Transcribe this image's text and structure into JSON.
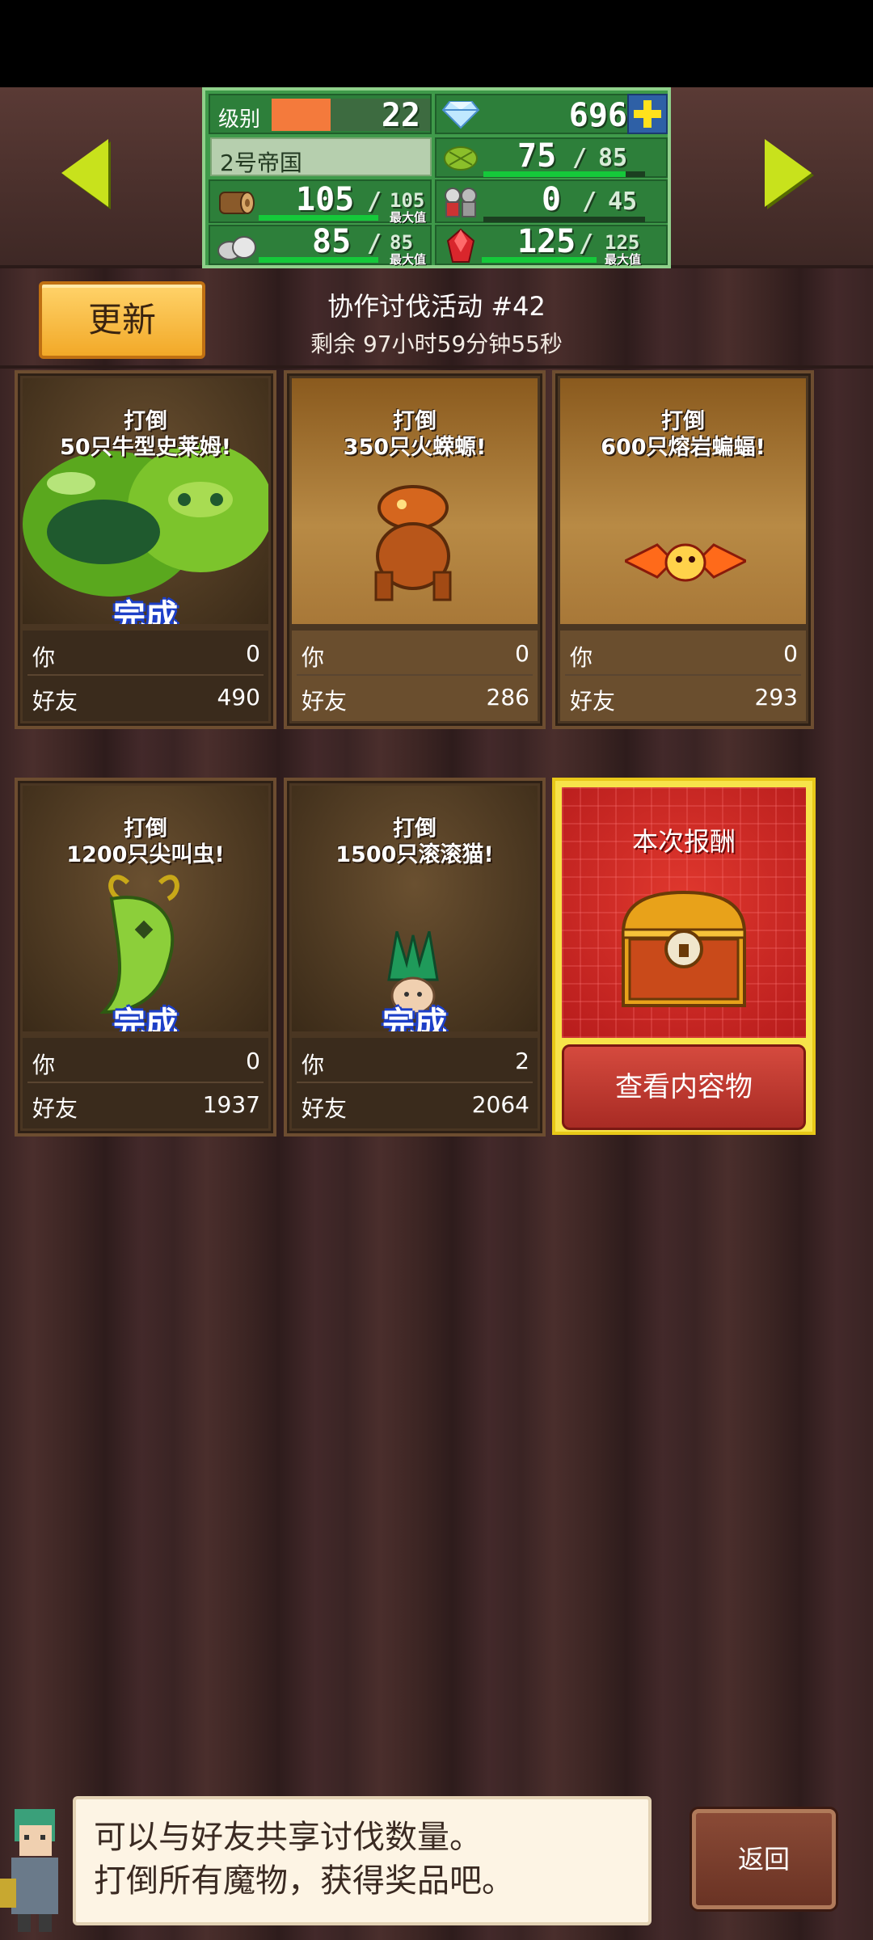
{
  "status": {
    "level_label": "级别",
    "level": "22",
    "gems": "696",
    "empire_name": "2号帝国",
    "food": "75",
    "food_max": "85",
    "wood": "105",
    "wood_max": "105",
    "soldiers": "0",
    "soldiers_max": "45",
    "stone": "85",
    "stone_max": "85",
    "ruby": "125",
    "ruby_max": "125",
    "slash": "/",
    "max_tag": "最大值",
    "level_progress": 0.37,
    "food_progress": 0.88,
    "soldiers_progress": 0.0
  },
  "header": {
    "update_label": "更新",
    "event_title": "协作讨伐活动 #42",
    "event_timer": "剩余 97小时59分钟55秒"
  },
  "labels": {
    "you": "你",
    "friends": "好友",
    "done": "完成"
  },
  "quests": [
    {
      "title_line1": "打倒",
      "title_line2": "50只牛型史莱姆!",
      "you": "0",
      "friends": "490",
      "done": true,
      "monster_icon": "slime-icon"
    },
    {
      "title_line1": "打倒",
      "title_line2": "350只火蝾螈!",
      "you": "0",
      "friends": "286",
      "done": false,
      "monster_icon": "salamander-icon"
    },
    {
      "title_line1": "打倒",
      "title_line2": "600只熔岩蝙蝠!",
      "you": "0",
      "friends": "293",
      "done": false,
      "monster_icon": "bat-icon"
    },
    {
      "title_line1": "打倒",
      "title_line2": "1200只尖叫虫!",
      "you": "0",
      "friends": "1937",
      "done": true,
      "monster_icon": "worm-icon"
    },
    {
      "title_line1": "打倒",
      "title_line2": "1500只滚滚猫!",
      "you": "2",
      "friends": "2064",
      "done": true,
      "monster_icon": "cat-icon"
    }
  ],
  "reward": {
    "title": "本次报酬",
    "view_button": "查看内容物",
    "icon": "treasure-chest-icon"
  },
  "hint": {
    "line1": "可以与好友共享讨伐数量。",
    "line2": "打倒所有魔物，获得奖品吧。"
  },
  "back_label": "返回",
  "colors": {
    "accent_green": "#3f9a4a",
    "arrow": "#c8e21c",
    "update_button": "#f2a928",
    "done_outline": "#1c3fc8",
    "reward_red": "#b71c1c"
  }
}
